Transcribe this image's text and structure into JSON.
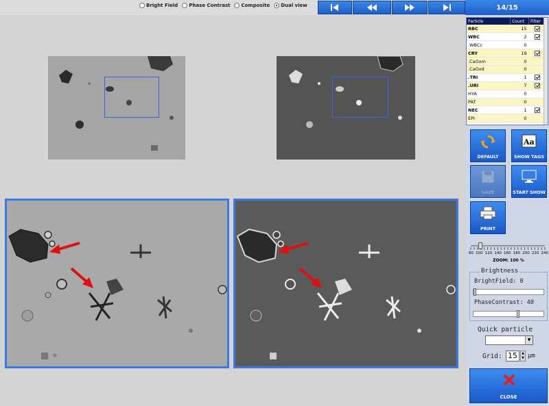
{
  "view_modes": {
    "options": [
      "Bright Field",
      "Phase Contrast",
      "Composite",
      "Dual view"
    ],
    "selected": "Dual view"
  },
  "counter": "14/15",
  "table": {
    "headers": [
      "Particle",
      "Count",
      "Filter"
    ],
    "rows": [
      {
        "name": "RBC",
        "count": "15",
        "filter": true,
        "bold": true,
        "yellow": true
      },
      {
        "name": "WBC",
        "count": "2",
        "filter": true,
        "bold": true,
        "yellow": false
      },
      {
        "name": ".WBCc",
        "count": "0",
        "filter": false,
        "bold": false,
        "yellow": false
      },
      {
        "name": "CRY",
        "count": "19",
        "filter": true,
        "bold": true,
        "yellow": true
      },
      {
        "name": ".CaOxm",
        "count": "0",
        "filter": false,
        "bold": false,
        "yellow": true
      },
      {
        "name": ".CaOxd",
        "count": "0",
        "filter": false,
        "bold": false,
        "yellow": true
      },
      {
        "name": ".TRI",
        "count": "1",
        "filter": true,
        "bold": true,
        "yellow": false
      },
      {
        "name": ".URI",
        "count": "7",
        "filter": true,
        "bold": true,
        "yellow": true
      },
      {
        "name": "HYA",
        "count": "0",
        "filter": false,
        "bold": false,
        "yellow": false
      },
      {
        "name": "PAT",
        "count": "0",
        "filter": false,
        "bold": false,
        "yellow": true
      },
      {
        "name": "NEC",
        "count": "1",
        "filter": true,
        "bold": true,
        "yellow": false
      },
      {
        "name": "EPI",
        "count": "0",
        "filter": false,
        "bold": false,
        "yellow": true
      }
    ]
  },
  "buttons": {
    "default": "DEFAULT",
    "show_tags": "SHOW TAGS",
    "save": "SAVE",
    "start_show": "START SHOW",
    "print": "PRINT",
    "close": "CLOSE"
  },
  "zoom": {
    "scale": [
      "80",
      "100",
      "120",
      "140",
      "160",
      "180",
      "200",
      "220",
      "240"
    ],
    "label": "ZOOM: 100 %",
    "value": 100
  },
  "brightness": {
    "legend": "Brightness",
    "brightfield_label": "BrightField: 0",
    "brightfield_value": 0,
    "phasecontrast_label": "PhaseContrast: 40",
    "phasecontrast_value": 40
  },
  "quick_particle": {
    "label": "Quick particle",
    "value": ""
  },
  "grid": {
    "label": "Grid:",
    "value": "15",
    "unit": "µm"
  },
  "colors": {
    "accent_blue": "#1d5fc8",
    "header_navy": "#0b1b5a",
    "highlight_yellow": "#fcf6c4",
    "arrow_red": "#e01010",
    "close_x_red": "#e02020"
  }
}
